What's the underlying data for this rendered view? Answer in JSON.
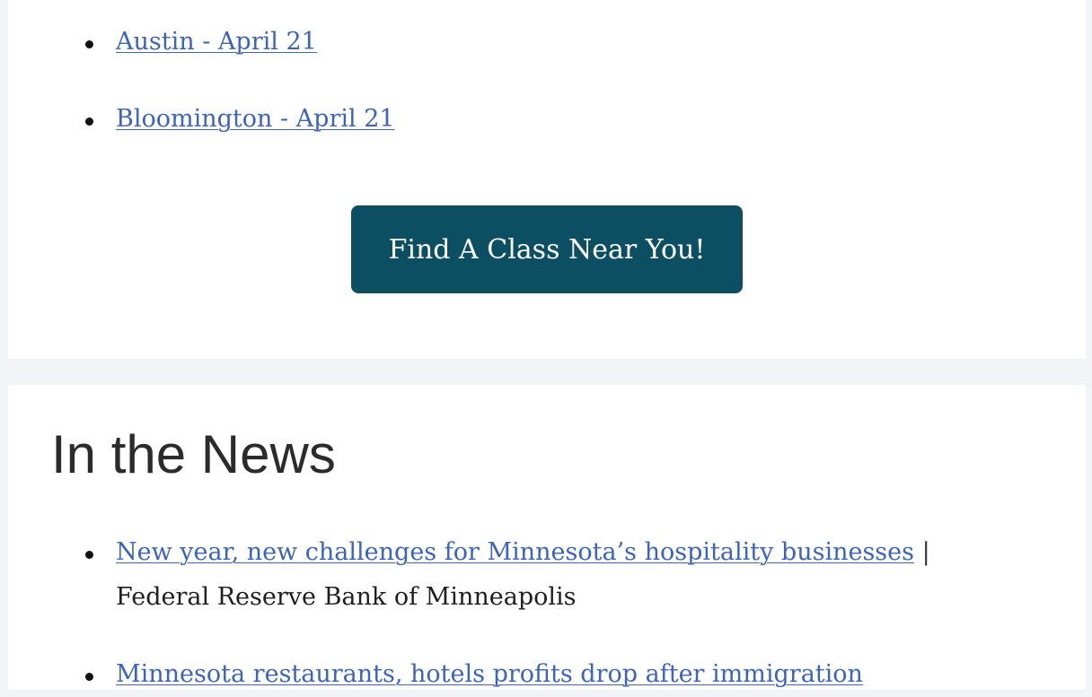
{
  "classes": {
    "items": [
      {
        "label": "Austin - April 21"
      },
      {
        "label": "Bloomington - April 21"
      }
    ],
    "cta_label": "Find A Class Near You!"
  },
  "news": {
    "title": "In the News",
    "items": [
      {
        "link": "New year, new challenges for Minnesota’s hospitality businesses",
        "separator": "|",
        "source": "Federal Reserve Bank of Minneapolis"
      },
      {
        "link": "Minnesota restaurants, hotels profits drop after immigration",
        "separator": "",
        "source": ""
      }
    ]
  },
  "colors": {
    "link": "#3b63c4",
    "button_bg": "#0c4f63",
    "page_bg": "#f1f3f7"
  }
}
